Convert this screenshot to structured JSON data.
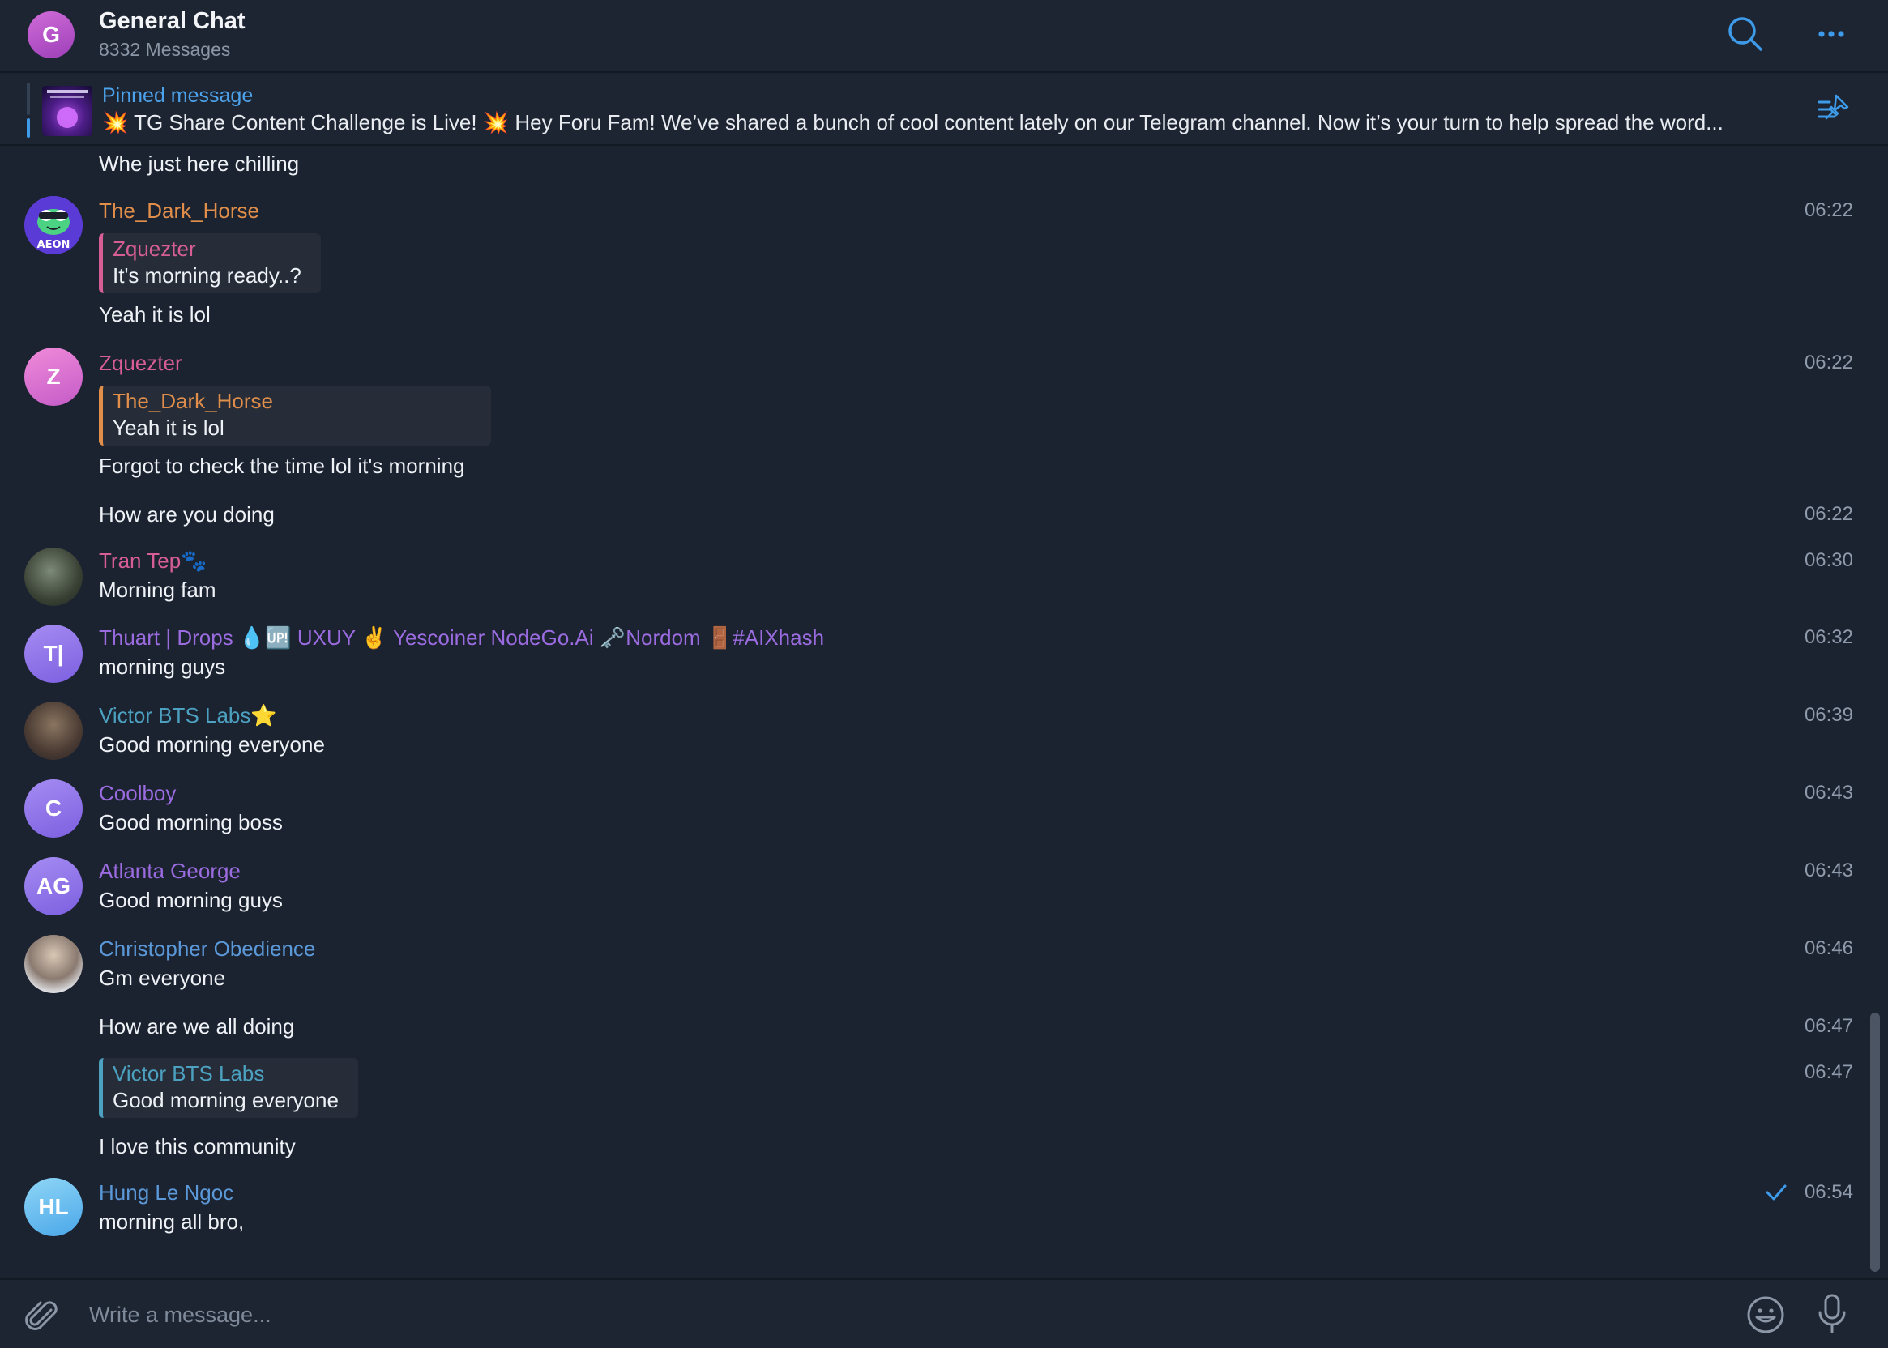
{
  "colors": {
    "background": "#1b2230",
    "accent": "#3d9be9",
    "name_orange": "#e08e4a",
    "name_pink": "#d75e94",
    "name_purple": "#9b6be0",
    "name_teal": "#4ca0c0",
    "name_blue": "#5b98d8"
  },
  "header": {
    "avatar_initial": "G",
    "title": "General Chat",
    "subtitle": "8332 Messages",
    "icons": [
      "search-icon",
      "more-icon"
    ]
  },
  "pinned": {
    "label": "Pinned message",
    "text": "💥 TG Share Content Challenge is Live! 💥   Hey Foru Fam! We’ve shared a bunch of cool content lately on our Telegram channel. Now it’s your turn to help spread the word..."
  },
  "messages": [
    {
      "text": "Whe just here chilling"
    },
    {
      "sender": "The_Dark_Horse",
      "avatar_label": "AEON",
      "time": "06:22",
      "reply": {
        "name": "Zquezter",
        "text": "It's morning ready..?"
      },
      "text": "Yeah it is lol"
    },
    {
      "sender": "Zquezter",
      "avatar_initial": "Z",
      "time": "06:22",
      "reply": {
        "name": "The_Dark_Horse",
        "text": "Yeah it is lol"
      },
      "text": "Forgot to check the time lol it's morning"
    },
    {
      "text": "How are you doing",
      "time": "06:22"
    },
    {
      "sender": "Tran Tep",
      "sender_emoji": "🐾",
      "time": "06:30",
      "text": "Morning fam"
    },
    {
      "sender": "Thuart | Drops 💧🆙 UXUY ✌️ Yescoiner NodeGo.Ai 🗝️Nordom 🚪#AIXhash",
      "avatar_initial": "T|",
      "time": "06:32",
      "text": "morning guys"
    },
    {
      "sender": "Victor BTS Labs",
      "sender_emoji": "⭐",
      "time": "06:39",
      "text": "Good morning everyone"
    },
    {
      "sender": "Coolboy",
      "avatar_initial": "C",
      "time": "06:43",
      "text": "Good morning boss"
    },
    {
      "sender": "Atlanta George",
      "avatar_initial": "AG",
      "time": "06:43",
      "text": "Good morning guys"
    },
    {
      "sender": "Christopher Obedience",
      "time": "06:46",
      "text": "Gm everyone"
    },
    {
      "text": "How are we all doing",
      "time": "06:47"
    },
    {
      "time": "06:47",
      "reply": {
        "name": "Victor BTS Labs",
        "text": "Good morning everyone"
      },
      "text": "I love this community"
    },
    {
      "sender": "Hung Le Ngoc",
      "avatar_initial": "HL",
      "time": "06:54",
      "text": "morning all bro,",
      "status_icon": "check-icon"
    }
  ],
  "composer": {
    "placeholder": "Write a message...",
    "icons": [
      "paperclip-icon",
      "emoji-icon",
      "microphone-icon"
    ]
  }
}
